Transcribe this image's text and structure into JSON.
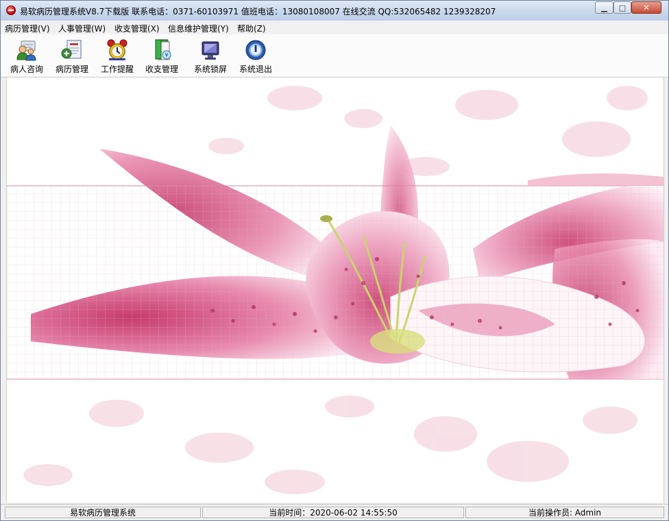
{
  "window": {
    "title": "易软病历管理系统V8.7下载版   联系电话：0371-60103971 值班电话：13080108007  在线交流 QQ:532065482 1239328207"
  },
  "menubar": {
    "items": [
      {
        "label": "病历管理(V)"
      },
      {
        "label": "人事管理(W)"
      },
      {
        "label": "收支管理(X)"
      },
      {
        "label": "信息维护管理(Y)"
      },
      {
        "label": "帮助(Z)"
      }
    ]
  },
  "toolbar": {
    "buttons": [
      {
        "label": "病人咨询",
        "icon": "users-icon"
      },
      {
        "label": "病历管理",
        "icon": "medical-record-icon"
      },
      {
        "label": "工作提醒",
        "icon": "alarm-clock-icon"
      },
      {
        "label": "收支管理",
        "icon": "finance-folder-icon"
      },
      {
        "label": "系统锁屏",
        "icon": "monitor-icon"
      },
      {
        "label": "系统退出",
        "icon": "power-icon"
      }
    ]
  },
  "statusbar": {
    "system_name": "易软病历管理系统",
    "current_time": "当前时间：2020-06-02 14:55:50",
    "operator": "当前操作员: Admin"
  },
  "colors": {
    "banner_line": "#d88aa0",
    "petal_pink": "#e0709a",
    "petal_white": "#fdf5f8",
    "stamen_green": "#c8d46a"
  }
}
